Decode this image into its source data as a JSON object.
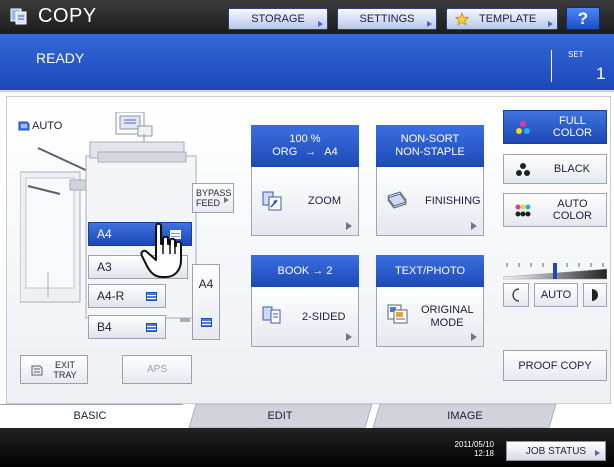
{
  "header": {
    "title": "COPY",
    "storage_label": "STORAGE",
    "settings_label": "SETTINGS",
    "template_label": "TEMPLATE",
    "help_label": "?"
  },
  "status": {
    "text": "READY",
    "set_label": "SET",
    "set_value": "1"
  },
  "machine": {
    "auto_label": "AUTO",
    "bypass_label_1": "BYPASS",
    "bypass_label_2": "FEED",
    "exit_tray_1": "EXIT",
    "exit_tray_2": "TRAY",
    "aps_label": "APS",
    "trays": [
      {
        "label": "A4",
        "active": true
      },
      {
        "label": "A3",
        "active": false
      },
      {
        "label": "A4-R",
        "active": false
      },
      {
        "label": "B4",
        "active": false
      }
    ],
    "lcf_label": "A4"
  },
  "zoom": {
    "ratio_text": "100 %",
    "orig_text": "ORG",
    "arrow_text": "→",
    "paper_text": "A4",
    "button_label": "ZOOM"
  },
  "finishing": {
    "line1": "NON-SORT",
    "line2": "NON-STAPLE",
    "button_label": "FINISHING"
  },
  "duplex": {
    "head": "BOOK → 2",
    "button_label": "2-SIDED"
  },
  "original_mode": {
    "head": "TEXT/PHOTO",
    "button_label_1": "ORIGINAL",
    "button_label_2": "MODE"
  },
  "color_mode": {
    "full_color_1": "FULL",
    "full_color_2": "COLOR",
    "black": "BLACK",
    "auto_color_1": "AUTO",
    "auto_color_2": "COLOR",
    "active": "full_color"
  },
  "density": {
    "auto_label": "AUTO",
    "level": 0.5
  },
  "proof_copy": "PROOF COPY",
  "tabs": [
    {
      "label": "BASIC",
      "active": true
    },
    {
      "label": "EDIT",
      "active": false
    },
    {
      "label": "IMAGE",
      "active": false
    }
  ],
  "footer": {
    "date": "2011/05/10",
    "time": "12:18",
    "job_status": "JOB STATUS"
  },
  "colors": {
    "accent_blue": "#1d49b8",
    "header_dark": "#1b1b1b"
  }
}
